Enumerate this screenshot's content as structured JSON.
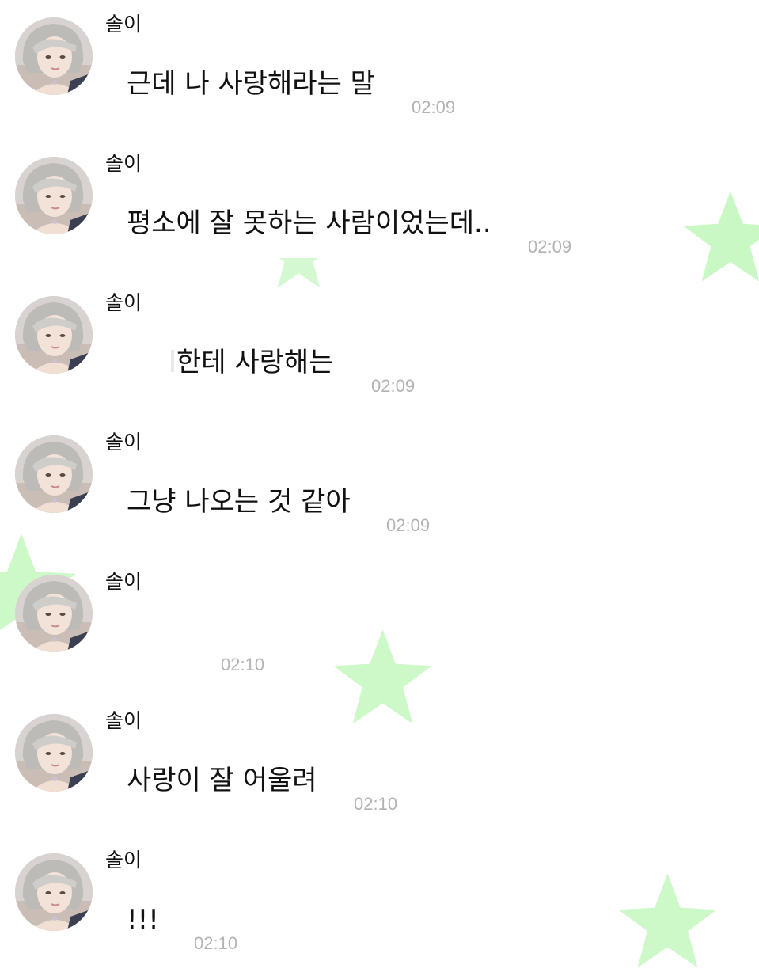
{
  "theme": {
    "star_color": "#b8f5b0",
    "time_color": "#b3b3b3",
    "text_color": "#111111"
  },
  "messages": [
    {
      "sender": "솔이",
      "text": "근데 나 사랑해라는 말",
      "time": "02:09",
      "avatar_icon": "profile-photo"
    },
    {
      "sender": "솔이",
      "text": "평소에 잘 못하는 사람이었는데..",
      "time": "02:09",
      "avatar_icon": "profile-photo"
    },
    {
      "sender": "솔이",
      "text": "한테 사랑해는",
      "time": "02:09",
      "avatar_icon": "profile-photo"
    },
    {
      "sender": "솔이",
      "text": "그냥 나오는 것 같아",
      "time": "02:09",
      "avatar_icon": "profile-photo"
    },
    {
      "sender": "솔이",
      "text": "",
      "time": "02:10",
      "avatar_icon": "profile-photo"
    },
    {
      "sender": "솔이",
      "text": "사랑이 잘 어울려",
      "time": "02:10",
      "avatar_icon": "profile-photo"
    },
    {
      "sender": "솔이",
      "text": "!!!",
      "time": "02:10",
      "avatar_icon": "profile-photo"
    }
  ]
}
